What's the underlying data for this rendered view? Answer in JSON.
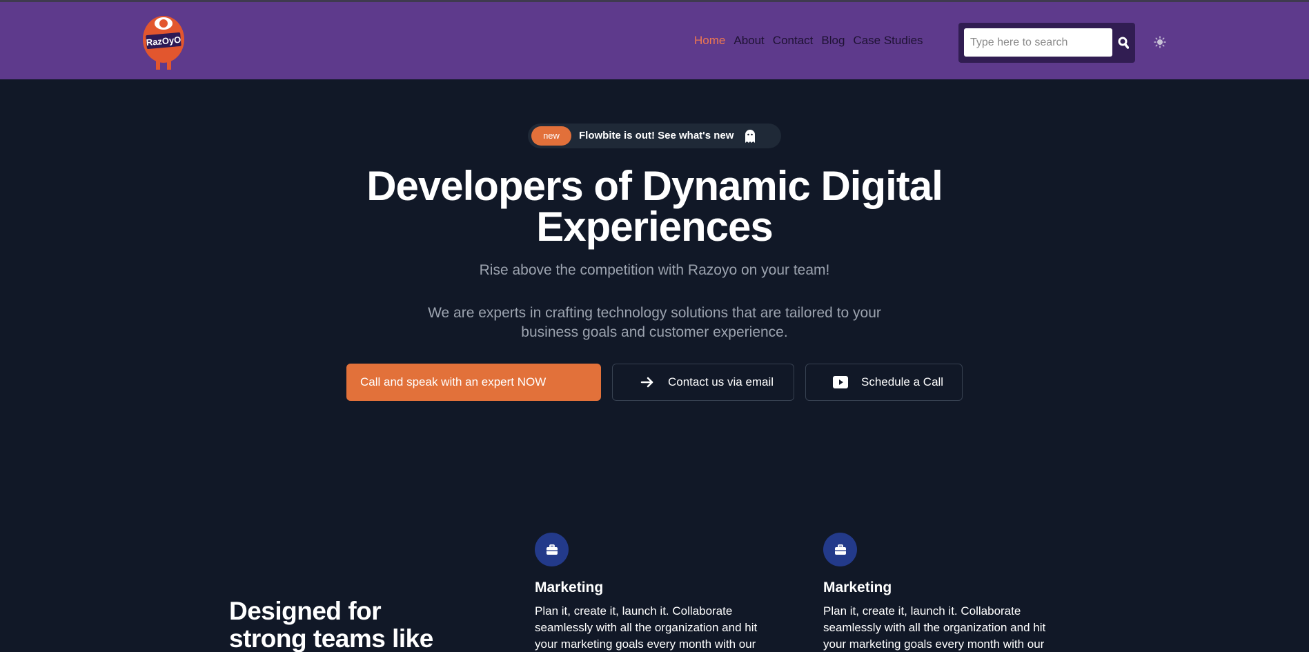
{
  "header": {
    "logo_text": "RazOyO",
    "nav": [
      {
        "label": "Home",
        "active": true
      },
      {
        "label": "About",
        "active": false
      },
      {
        "label": "Contact",
        "active": false
      },
      {
        "label": "Blog",
        "active": false
      },
      {
        "label": "Case Studies",
        "active": false
      }
    ],
    "search": {
      "placeholder": "Type here to search",
      "value": "",
      "icon": "search-icon"
    },
    "theme_toggle_icon": "sun-icon"
  },
  "announcement": {
    "badge": "new",
    "text": "Flowbite is out! See what's new",
    "icon": "ghost-icon"
  },
  "hero": {
    "title_line1": "Developers of Dynamic Digital",
    "title_line2": "Experiences",
    "subtitle": "Rise above the competition with Razoyo on your team!",
    "description": "We are experts in crafting technology solutions that are tailored to your business goals and customer experience.",
    "buttons": {
      "primary": "Call and speak with an expert NOW",
      "email": "Contact us via email",
      "call": "Schedule a Call"
    }
  },
  "features": {
    "heading_line1": "Designed for",
    "heading_line2": "strong teams like",
    "items": [
      {
        "icon": "briefcase-icon",
        "title": "Marketing",
        "text": "Plan it, create it, launch it. Collaborate seamlessly with all the organization and hit your marketing goals every month with our"
      },
      {
        "icon": "briefcase-icon",
        "title": "Marketing",
        "text": "Plan it, create it, launch it. Collaborate seamlessly with all the organization and hit your marketing goals every month with our"
      }
    ]
  },
  "colors": {
    "header_bg": "#5e3a8c",
    "page_bg": "#111827",
    "accent_orange": "#e2713a",
    "nav_active": "#f07850",
    "icon_circle": "#233a8a"
  }
}
